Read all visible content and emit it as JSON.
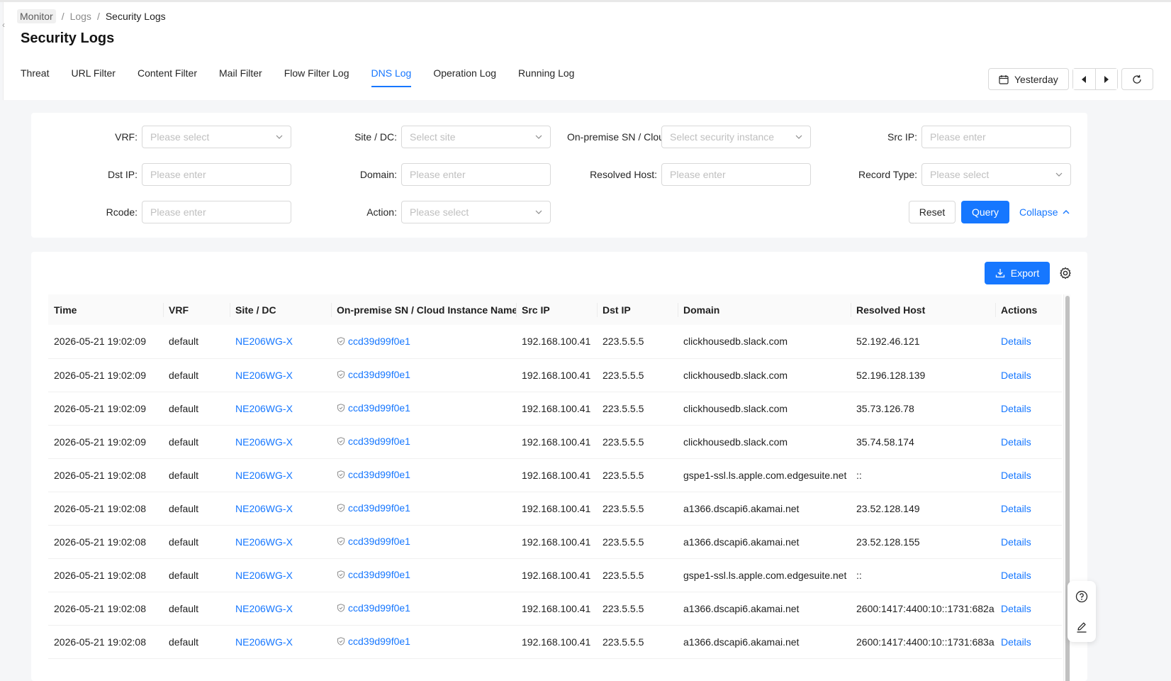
{
  "breadcrumb": {
    "root": "Monitor",
    "sep": "/",
    "mid": "Logs",
    "current": "Security Logs"
  },
  "page_title": "Security Logs",
  "tabs": [
    {
      "label": "Threat"
    },
    {
      "label": "URL Filter"
    },
    {
      "label": "Content Filter"
    },
    {
      "label": "Mail Filter"
    },
    {
      "label": "Flow Filter Log"
    },
    {
      "label": "DNS Log"
    },
    {
      "label": "Operation Log"
    },
    {
      "label": "Running Log"
    }
  ],
  "active_tab": "DNS Log",
  "date": {
    "label": "Yesterday"
  },
  "filters": {
    "vrf": {
      "label": "VRF",
      "placeholder": "Please select"
    },
    "site": {
      "label": "Site / DC",
      "placeholder": "Select site"
    },
    "instance": {
      "label": "On-premise SN / Clou",
      "placeholder": "Select security instance"
    },
    "src_ip": {
      "label": "Src IP",
      "placeholder": "Please enter"
    },
    "dst_ip": {
      "label": "Dst IP",
      "placeholder": "Please enter"
    },
    "domain": {
      "label": "Domain",
      "placeholder": "Please enter"
    },
    "resolved_host": {
      "label": "Resolved Host",
      "placeholder": "Please enter"
    },
    "record_type": {
      "label": "Record Type",
      "placeholder": "Please select"
    },
    "rcode": {
      "label": "Rcode",
      "placeholder": "Please enter"
    },
    "action": {
      "label": "Action",
      "placeholder": "Please select"
    }
  },
  "buttons": {
    "reset": "Reset",
    "query": "Query",
    "collapse": "Collapse",
    "export": "Export"
  },
  "table": {
    "columns": [
      "Time",
      "VRF",
      "Site / DC",
      "On-premise SN / Cloud Instance Name",
      "Src IP",
      "Dst IP",
      "Domain",
      "Resolved Host",
      "Actions"
    ],
    "rows": [
      {
        "time": "2026-05-21 19:02:09",
        "vrf": "default",
        "site": "NE206WG-X",
        "instance": "ccd39d99f0e1",
        "src_ip": "192.168.100.41",
        "dst_ip": "223.5.5.5",
        "domain": "clickhousedb.slack.com",
        "resolved_host": "52.192.46.121",
        "action": "Details"
      },
      {
        "time": "2026-05-21 19:02:09",
        "vrf": "default",
        "site": "NE206WG-X",
        "instance": "ccd39d99f0e1",
        "src_ip": "192.168.100.41",
        "dst_ip": "223.5.5.5",
        "domain": "clickhousedb.slack.com",
        "resolved_host": "52.196.128.139",
        "action": "Details"
      },
      {
        "time": "2026-05-21 19:02:09",
        "vrf": "default",
        "site": "NE206WG-X",
        "instance": "ccd39d99f0e1",
        "src_ip": "192.168.100.41",
        "dst_ip": "223.5.5.5",
        "domain": "clickhousedb.slack.com",
        "resolved_host": "35.73.126.78",
        "action": "Details"
      },
      {
        "time": "2026-05-21 19:02:09",
        "vrf": "default",
        "site": "NE206WG-X",
        "instance": "ccd39d99f0e1",
        "src_ip": "192.168.100.41",
        "dst_ip": "223.5.5.5",
        "domain": "clickhousedb.slack.com",
        "resolved_host": "35.74.58.174",
        "action": "Details"
      },
      {
        "time": "2026-05-21 19:02:08",
        "vrf": "default",
        "site": "NE206WG-X",
        "instance": "ccd39d99f0e1",
        "src_ip": "192.168.100.41",
        "dst_ip": "223.5.5.5",
        "domain": "gspe1-ssl.ls.apple.com.edgesuite.net",
        "resolved_host": "::",
        "action": "Details"
      },
      {
        "time": "2026-05-21 19:02:08",
        "vrf": "default",
        "site": "NE206WG-X",
        "instance": "ccd39d99f0e1",
        "src_ip": "192.168.100.41",
        "dst_ip": "223.5.5.5",
        "domain": "a1366.dscapi6.akamai.net",
        "resolved_host": "23.52.128.149",
        "action": "Details"
      },
      {
        "time": "2026-05-21 19:02:08",
        "vrf": "default",
        "site": "NE206WG-X",
        "instance": "ccd39d99f0e1",
        "src_ip": "192.168.100.41",
        "dst_ip": "223.5.5.5",
        "domain": "a1366.dscapi6.akamai.net",
        "resolved_host": "23.52.128.155",
        "action": "Details"
      },
      {
        "time": "2026-05-21 19:02:08",
        "vrf": "default",
        "site": "NE206WG-X",
        "instance": "ccd39d99f0e1",
        "src_ip": "192.168.100.41",
        "dst_ip": "223.5.5.5",
        "domain": "gspe1-ssl.ls.apple.com.edgesuite.net",
        "resolved_host": "::",
        "action": "Details"
      },
      {
        "time": "2026-05-21 19:02:08",
        "vrf": "default",
        "site": "NE206WG-X",
        "instance": "ccd39d99f0e1",
        "src_ip": "192.168.100.41",
        "dst_ip": "223.5.5.5",
        "domain": "a1366.dscapi6.akamai.net",
        "resolved_host": "2600:1417:4400:10::1731:682a",
        "action": "Details"
      },
      {
        "time": "2026-05-21 19:02:08",
        "vrf": "default",
        "site": "NE206WG-X",
        "instance": "ccd39d99f0e1",
        "src_ip": "192.168.100.41",
        "dst_ip": "223.5.5.5",
        "domain": "a1366.dscapi6.akamai.net",
        "resolved_host": "2600:1417:4400:10::1731:683a",
        "action": "Details"
      }
    ]
  },
  "colors": {
    "accent": "#1677ff",
    "text": "#1f1f1f",
    "muted": "#8c8c8c",
    "border": "#d9d9d9",
    "bg": "#f5f6f8"
  },
  "icons": [
    "calendar-icon",
    "caret-left-icon",
    "caret-right-icon",
    "refresh-icon",
    "chevron-down-icon",
    "chevron-up-icon",
    "download-icon",
    "settings-icon",
    "shield-check-icon",
    "help-icon",
    "edit-icon"
  ]
}
